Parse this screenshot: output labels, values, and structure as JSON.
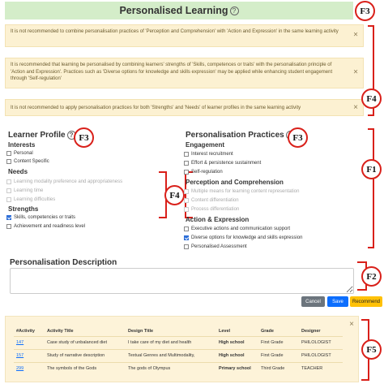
{
  "title": "Personalised Learning",
  "help_glyph": "?",
  "badges": {
    "f1": "F1",
    "f2": "F2",
    "f3": "F3",
    "f4": "F4",
    "f5": "F5"
  },
  "alerts": [
    "It is not recommended to combine personalisation practices of 'Perception and Comprehension' with 'Action and Expression' in the same learning activity",
    "It is recommended that learning be personalised by combining learners' strengths of 'Skills, competences or traits' with the personalisation principle of 'Action and Expression'. Practices such as 'Diverse options for knowledge and skills expression' may be applied while enhancing student engagement through 'Self-regulation'",
    "It is not recommended to apply personalisation practices for both 'Strengths' and 'Needs' of learner profiles in the same learning activity"
  ],
  "close_glyph": "×",
  "learner_profile": {
    "heading": "Learner Profile",
    "interests": {
      "label": "Interests",
      "items": [
        "Personal",
        "Content Specific"
      ]
    },
    "needs": {
      "label": "Needs",
      "items": [
        "Learning modality preference and appropriateness",
        "Learning time",
        "Learning difficulties"
      ]
    },
    "strengths": {
      "label": "Strengths",
      "items": [
        "Skills, competencies or traits",
        "Achievement and readiness level"
      ]
    }
  },
  "practices": {
    "heading": "Personalisation Practices",
    "engagement": {
      "label": "Engagement",
      "items": [
        "Interest recruitment",
        "Effort & persistence sustainment",
        "Self-regulation"
      ]
    },
    "perception": {
      "label": "Perception and Comprehension",
      "items": [
        "Multiple means for learning content representation",
        "Content differentiation",
        "Process differentiation"
      ]
    },
    "action": {
      "label": "Action & Expression",
      "items": [
        "Executive actions and communication support",
        "Diverse options for knowledge and skills expression",
        "Personalised Assessment"
      ]
    }
  },
  "description": {
    "title": "Personalisation Description",
    "value": ""
  },
  "buttons": {
    "cancel": "Cancel",
    "save": "Save",
    "recommend": "Recommend"
  },
  "activities": {
    "headers": [
      "#Activity",
      "Activity Title",
      "Design Title",
      "Level",
      "Grade",
      "Designer"
    ],
    "rows": [
      [
        "147",
        "Case study of unbalanced diet",
        "I take care of my diet and health",
        "High school",
        "First Grade",
        "PHILOLOGIST"
      ],
      [
        "157",
        "Study of narrative description",
        "Textual Genres and Multimodality,",
        "High school",
        "First Grade",
        "PHILOLOGIST"
      ],
      [
        "299",
        "The symbols of the Gods",
        "The gods of Olympus",
        "Primary school",
        "Third Grade",
        "TEACHER"
      ]
    ]
  }
}
